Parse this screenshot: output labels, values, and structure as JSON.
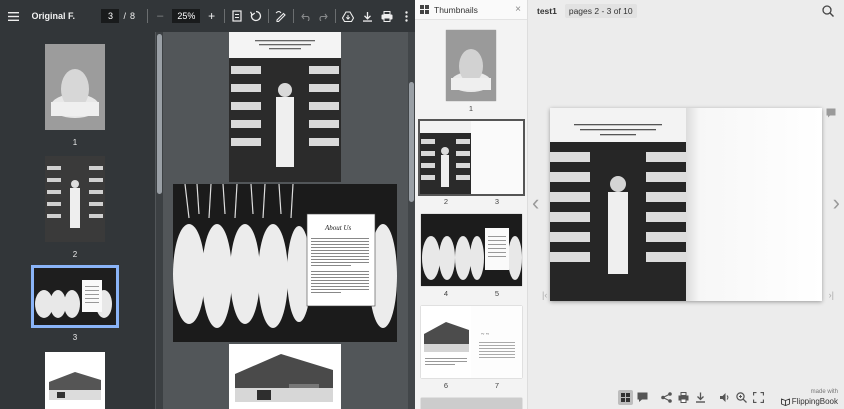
{
  "pdf": {
    "title": "Original F...",
    "current_page": "3",
    "page_sep": "/",
    "total_pages": "8",
    "zoom": "25%",
    "zoom_out": "–",
    "zoom_in": "+",
    "thumbnails": [
      {
        "label": "1"
      },
      {
        "label": "2"
      },
      {
        "label": "3"
      }
    ],
    "about_title": "About Us"
  },
  "fb": {
    "panel_title": "Thumbnails",
    "close": "×",
    "doc_title": "test1",
    "pages_label": "pages 2 - 3 of 10",
    "thumb_labels": [
      "1",
      "2",
      "3",
      "4",
      "5",
      "6",
      "7"
    ],
    "brand_small": "made with",
    "brand_name": "FlippingBook"
  },
  "colors": {
    "accent": "#8ab4f8",
    "toolbar_bg": "#323639",
    "viewer_bg": "#525659"
  }
}
